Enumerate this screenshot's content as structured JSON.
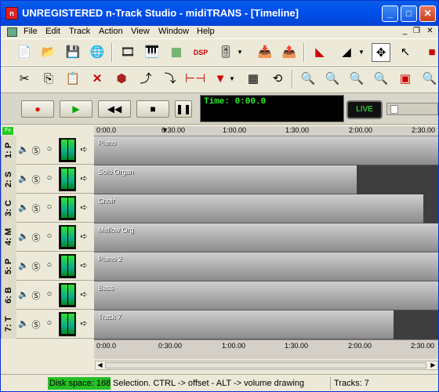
{
  "window": {
    "title": "UNREGISTERED n-Track Studio - midiTRANS - [Timeline]",
    "app_icon": "n-track-app-icon"
  },
  "menu": {
    "items": [
      "File",
      "Edit",
      "Track",
      "Action",
      "View",
      "Window",
      "Help"
    ]
  },
  "transport": {
    "time_label": "Time: 0:00.0",
    "live_label": "LIVE"
  },
  "fx_label": "Fx",
  "tracks": [
    {
      "label": "1: P",
      "lane_label": "Piano"
    },
    {
      "label": "2: S",
      "lane_label": "Solo Organ"
    },
    {
      "label": "3: C",
      "lane_label": "Choir"
    },
    {
      "label": "4: M",
      "lane_label": "Mellow Org"
    },
    {
      "label": "5: P",
      "lane_label": "Piano 2"
    },
    {
      "label": "6: B",
      "lane_label": "Bass"
    },
    {
      "label": "7: T",
      "lane_label": "Track 7"
    }
  ],
  "ruler": {
    "ticks": [
      "0:00.0",
      "0:30.00",
      "1:00.00",
      "1:30.00",
      "2:00.00",
      "2:30.00"
    ]
  },
  "bottom_ruler": {
    "ticks": [
      "0:00.0",
      "0:30.00",
      "1:00.00",
      "1:30.00",
      "2:00.00",
      "2:30.00"
    ]
  },
  "status": {
    "disk": "Disk space: 168",
    "hint": "Selection. CTRL -> offset - ALT -> volume drawing",
    "tracks": "Tracks: 7"
  }
}
